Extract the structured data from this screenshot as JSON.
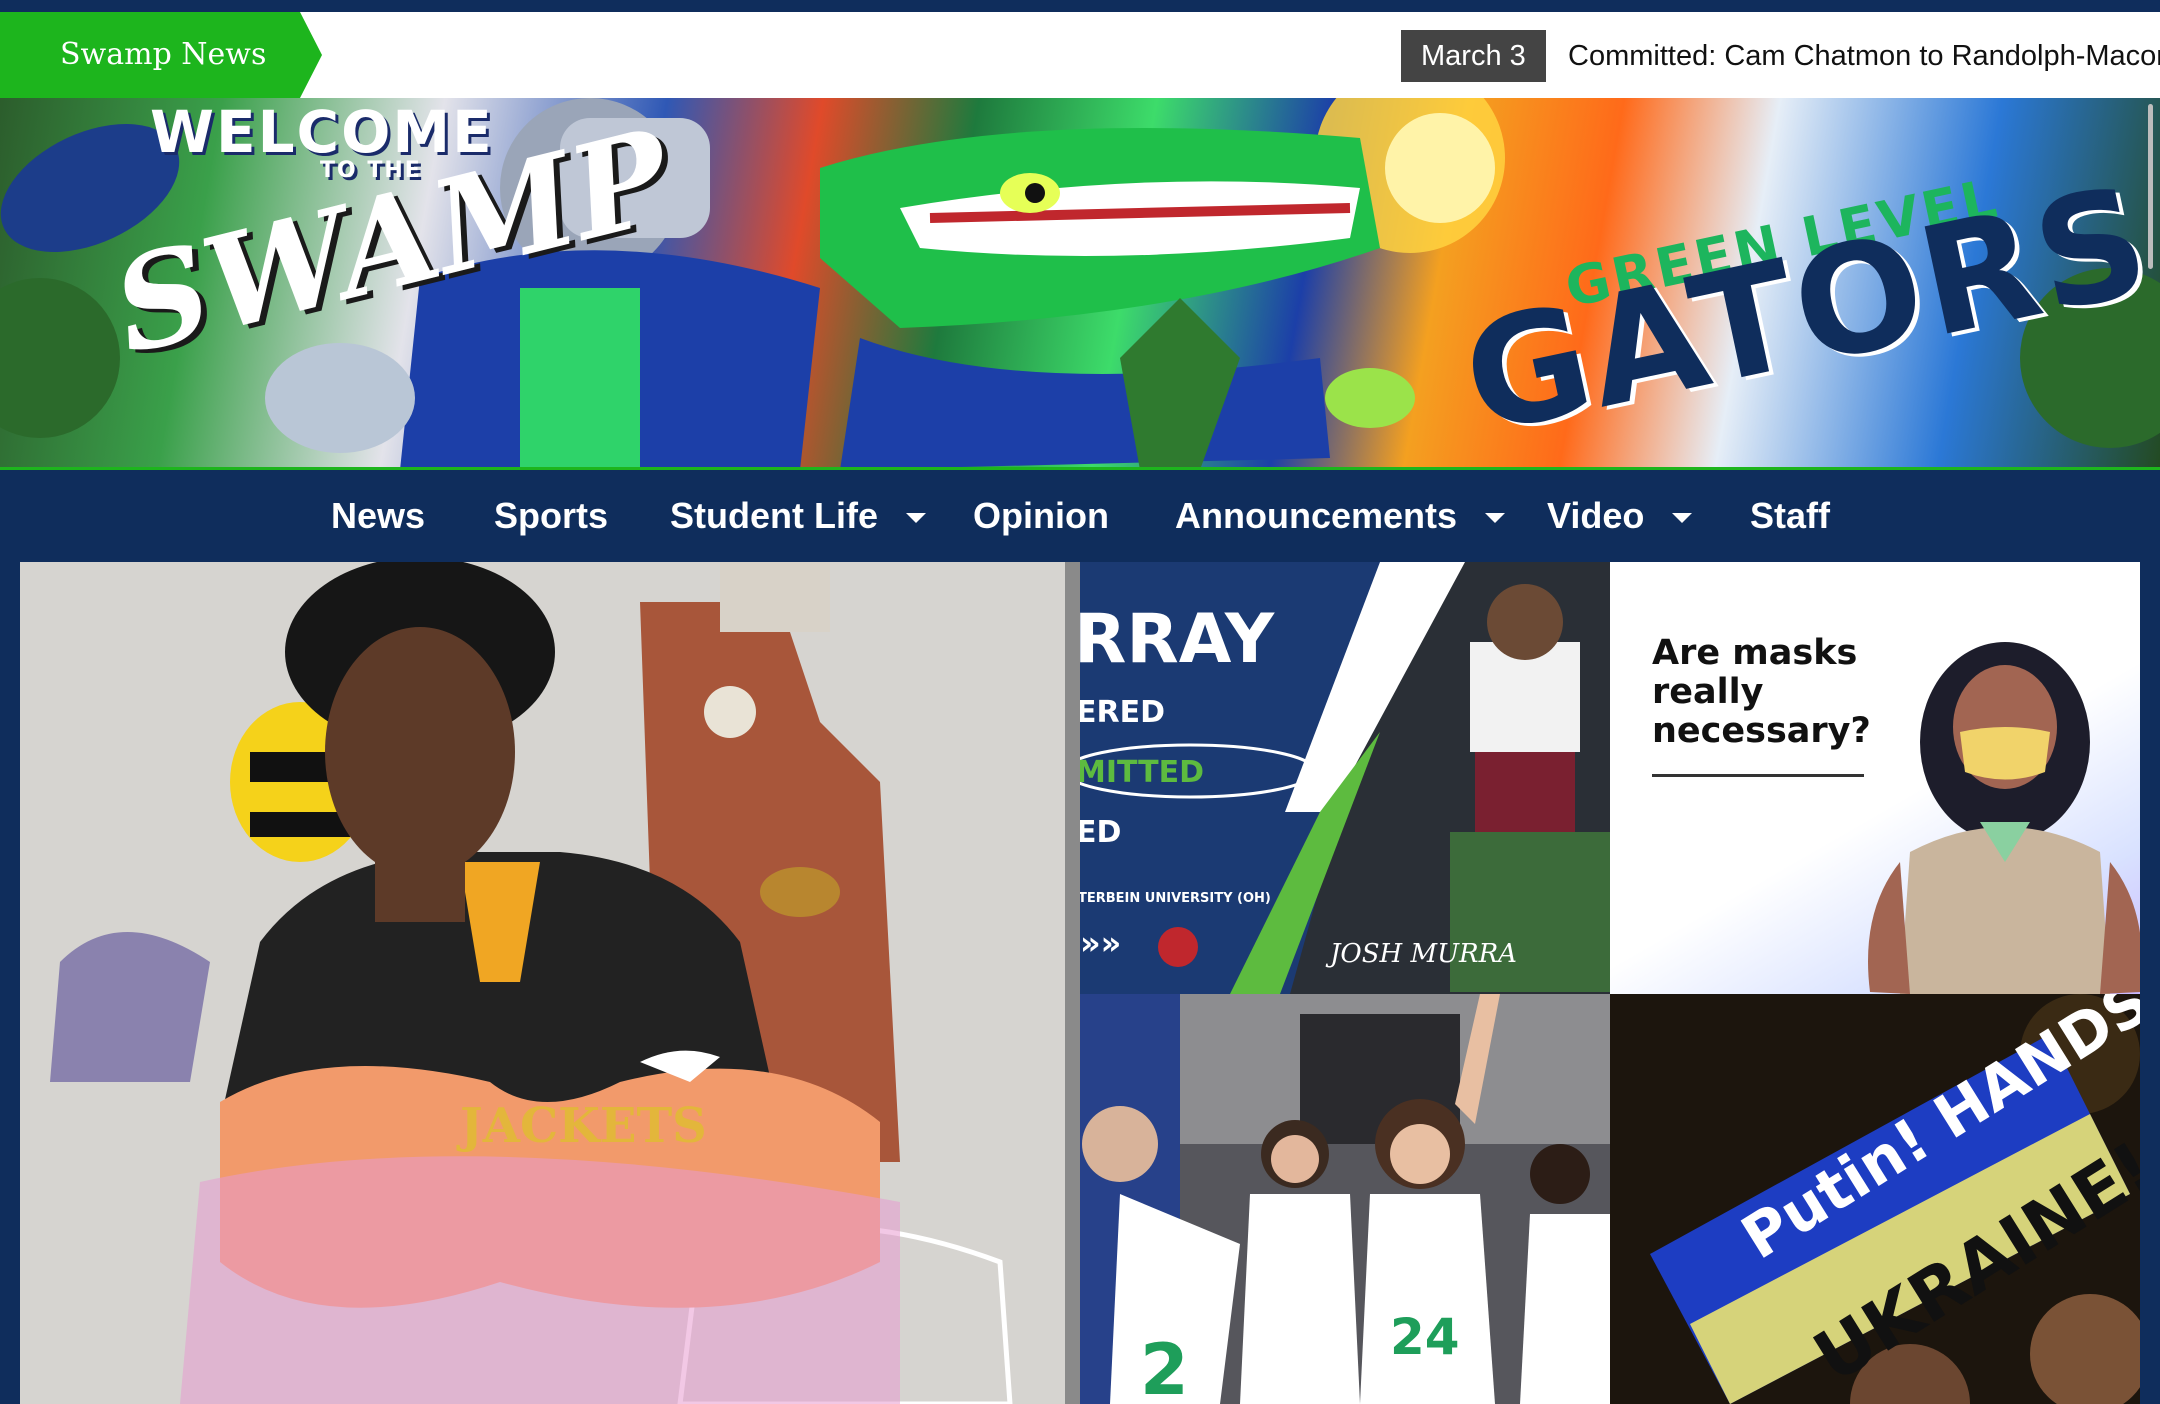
{
  "ticker": {
    "label": "Swamp News",
    "date": "March 3",
    "headline": "Committed: Cam Chatmon to Randolph-Macon"
  },
  "banner": {
    "text_welcome": "WELCOME",
    "text_to_the": "TO THE",
    "text_swamp": "SWAMP",
    "text_green_level": "GREEN LEVEL",
    "text_gators": "GATORS"
  },
  "nav": {
    "items": [
      {
        "label": "News",
        "has_dropdown": false
      },
      {
        "label": "Sports",
        "has_dropdown": false
      },
      {
        "label": "Student Life",
        "has_dropdown": true
      },
      {
        "label": "Opinion",
        "has_dropdown": false
      },
      {
        "label": "Announcements",
        "has_dropdown": true
      },
      {
        "label": "Video",
        "has_dropdown": true
      },
      {
        "label": "Staff",
        "has_dropdown": false
      }
    ]
  },
  "stories": {
    "feature_jersey_text": "JACKETS",
    "commit_graphic": {
      "name_fragment": "RRAY",
      "line1": "ERED",
      "line2": "MITTED",
      "line3": "ED",
      "school": "TERBEIN UNIVERSITY (OH)",
      "signature": "JOSH MURRA"
    },
    "masks_question": "Are masks really necessary?",
    "protest_sign": {
      "line1": "Putin! HANDS OFF",
      "line2": "UKRAINE!"
    }
  },
  "colors": {
    "navy": "#0f2d5c",
    "green": "#1db51d",
    "ticker_date_bg": "#444444"
  }
}
